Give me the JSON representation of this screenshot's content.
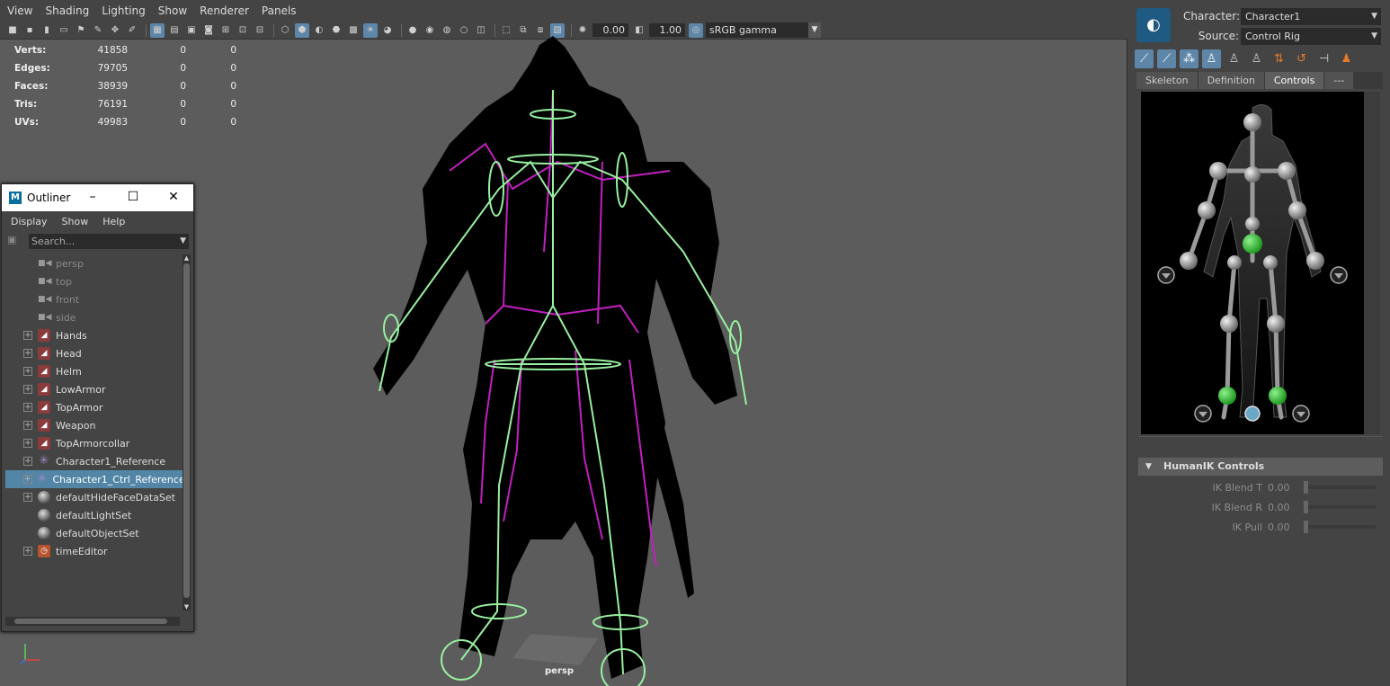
{
  "menubar": {
    "items": [
      "View",
      "Shading",
      "Lighting",
      "Show",
      "Renderer",
      "Panels"
    ]
  },
  "toolbar": {
    "exposure": "0.00",
    "gamma": "1.00",
    "colorspace": "sRGB gamma"
  },
  "hud": {
    "rows": [
      {
        "label": "Verts:",
        "v1": "41858",
        "v2": "0",
        "v3": "0"
      },
      {
        "label": "Edges:",
        "v1": "79705",
        "v2": "0",
        "v3": "0"
      },
      {
        "label": "Faces:",
        "v1": "38939",
        "v2": "0",
        "v3": "0"
      },
      {
        "label": "Tris:",
        "v1": "76191",
        "v2": "0",
        "v3": "0"
      },
      {
        "label": "UVs:",
        "v1": "49983",
        "v2": "0",
        "v3": "0"
      }
    ]
  },
  "viewport": {
    "camera_label": "persp"
  },
  "outliner": {
    "title": "Outliner",
    "menu": [
      "Display",
      "Show",
      "Help"
    ],
    "search_placeholder": "Search...",
    "items": [
      {
        "label": "persp",
        "icon": "camera-icon",
        "expandable": false,
        "dim": true,
        "selected": false
      },
      {
        "label": "top",
        "icon": "camera-icon",
        "expandable": false,
        "dim": true,
        "selected": false
      },
      {
        "label": "front",
        "icon": "camera-icon",
        "expandable": false,
        "dim": true,
        "selected": false
      },
      {
        "label": "side",
        "icon": "camera-icon",
        "expandable": false,
        "dim": true,
        "selected": false
      },
      {
        "label": "Hands",
        "icon": "mesh-icon",
        "expandable": true,
        "dim": false,
        "selected": false
      },
      {
        "label": "Head",
        "icon": "mesh-icon",
        "expandable": true,
        "dim": false,
        "selected": false
      },
      {
        "label": "Helm",
        "icon": "mesh-icon",
        "expandable": true,
        "dim": false,
        "selected": false
      },
      {
        "label": "LowArmor",
        "icon": "mesh-icon",
        "expandable": true,
        "dim": false,
        "selected": false
      },
      {
        "label": "TopArmor",
        "icon": "mesh-icon",
        "expandable": true,
        "dim": false,
        "selected": false
      },
      {
        "label": "Weapon",
        "icon": "mesh-icon",
        "expandable": true,
        "dim": false,
        "selected": false
      },
      {
        "label": "TopArmorcollar",
        "icon": "mesh-icon",
        "expandable": true,
        "dim": false,
        "selected": false
      },
      {
        "label": "Character1_Reference",
        "icon": "character-icon",
        "expandable": true,
        "dim": false,
        "selected": false
      },
      {
        "label": "Character1_Ctrl_Reference",
        "icon": "character-icon",
        "expandable": true,
        "dim": false,
        "selected": true
      },
      {
        "label": "defaultHideFaceDataSet",
        "icon": "set-icon",
        "expandable": true,
        "dim": false,
        "selected": false
      },
      {
        "label": "defaultLightSet",
        "icon": "set-icon",
        "expandable": false,
        "dim": false,
        "selected": false
      },
      {
        "label": "defaultObjectSet",
        "icon": "set-icon",
        "expandable": false,
        "dim": false,
        "selected": false
      },
      {
        "label": "timeEditor",
        "icon": "time-editor-icon",
        "expandable": true,
        "dim": false,
        "selected": false
      }
    ]
  },
  "humanik": {
    "character_label": "Character:",
    "character_value": "Character1",
    "source_label": "Source:",
    "source_value": "Control Rig",
    "tabs": [
      "Skeleton",
      "Definition",
      "Controls",
      "---"
    ],
    "active_tab": "Controls",
    "controls_header": "HumanIK Controls",
    "ik_rows": [
      {
        "label": "IK Blend T",
        "value": "0.00"
      },
      {
        "label": "IK Blend R",
        "value": "0.00"
      },
      {
        "label": "IK Pull",
        "value": "0.00"
      }
    ]
  },
  "colors": {
    "selection": "#5285a6",
    "skeleton": "#98f0a0",
    "rig": "#c020c0",
    "effector_active": "#3ccf3c"
  }
}
